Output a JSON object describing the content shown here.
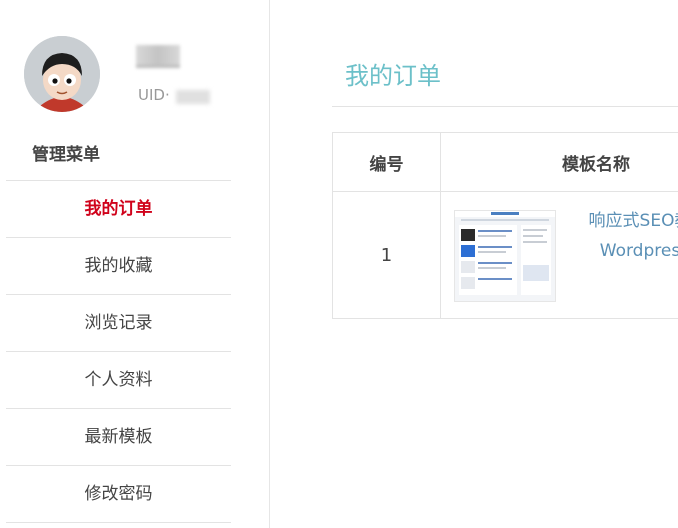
{
  "profile": {
    "uid_label": "UID·"
  },
  "sidebar": {
    "menu_title": "管理菜单",
    "items": [
      {
        "label": "我的订单",
        "active": true
      },
      {
        "label": "我的收藏",
        "active": false
      },
      {
        "label": "浏览记录",
        "active": false
      },
      {
        "label": "个人资料",
        "active": false
      },
      {
        "label": "最新模板",
        "active": false
      },
      {
        "label": "修改密码",
        "active": false
      }
    ]
  },
  "main": {
    "title": "我的订单",
    "table": {
      "headers": [
        "编号",
        "模板名称"
      ],
      "rows": [
        {
          "number": "1",
          "name_line1": "响应式SEO教",
          "name_line2": "Wordpres"
        }
      ]
    }
  },
  "colors": {
    "accent": "#6cc0c9",
    "active_menu": "#d0021b",
    "link": "#5a8fb5"
  }
}
